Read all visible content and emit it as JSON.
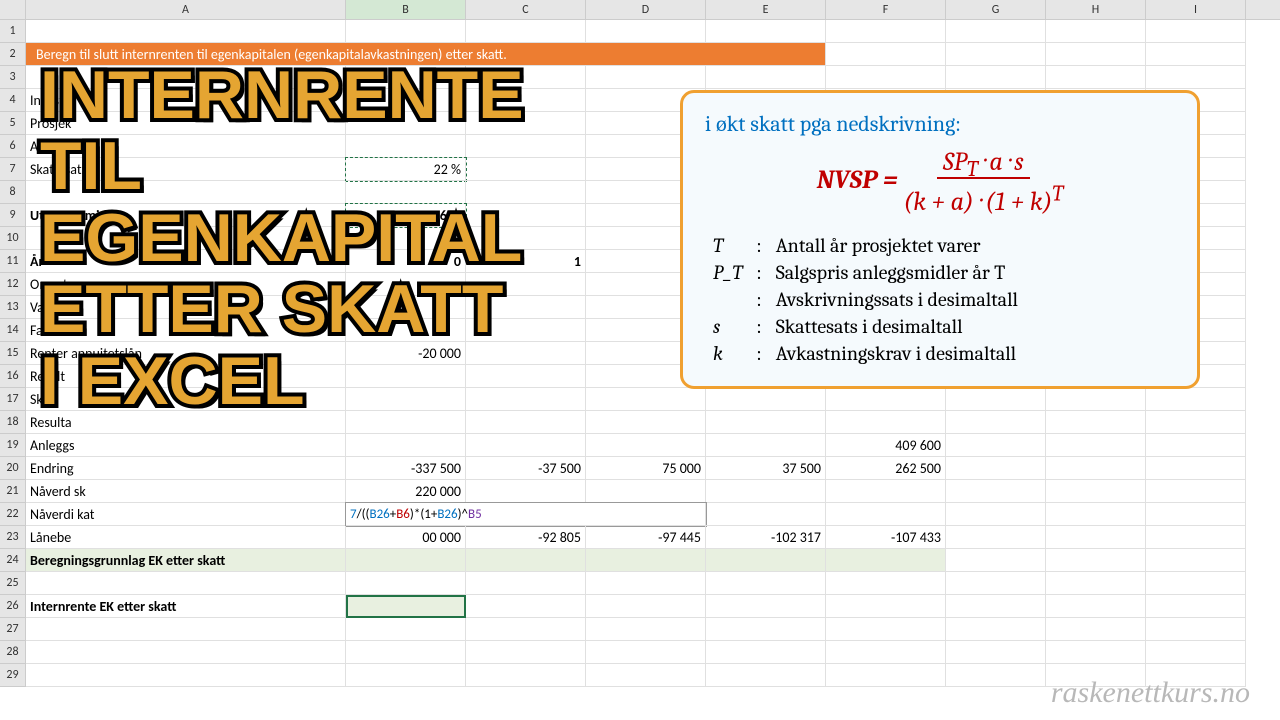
{
  "columns": [
    "A",
    "B",
    "C",
    "D",
    "E",
    "F",
    "G",
    "H",
    "I"
  ],
  "banner": "Beregn til slutt internrenten til egenkapitalen (egenkapitalavkastningen) etter skatt.",
  "rows": {
    "r4": {
      "A": "Investe"
    },
    "r5": {
      "A": "Prosjek"
    },
    "r6": {
      "A": "Avskriv"
    },
    "r7": {
      "A": "Skattesats",
      "B": "22 %"
    },
    "r9": {
      "A": "Utranger               midler",
      "B": "409 600"
    },
    "r11": {
      "A": "År",
      "B": "0",
      "C": "1"
    },
    "r12": {
      "A": "Omset"
    },
    "r13": {
      "A": "Variable"
    },
    "r14": {
      "A": "Faste k"
    },
    "r15": {
      "A": "Renter annuitetslån",
      "B": "-20 000"
    },
    "r16": {
      "A": "Result"
    },
    "r17": {
      "A": "Skatt"
    },
    "r18": {
      "A": "Resulta"
    },
    "r19": {
      "A": "Anleggs",
      "F": "409 600"
    },
    "r20": {
      "A": "Endring",
      "B": "-337 500",
      "C": "-37 500",
      "D": "75 000",
      "E": "37 500",
      "F": "262 500"
    },
    "r21": {
      "A": "Nåverd              sk",
      "B": "220 000"
    },
    "r22": {
      "A": "Nåverdi   kat",
      "B_formula": "7/((B26+B6)*(1+B26)^B5"
    },
    "r23": {
      "A": "Lånebe",
      "B": "00 000",
      "C": "-92 805",
      "D": "-97 445",
      "E": "-102 317",
      "F": "-107 433"
    },
    "r24": {
      "A": "Beregningsgrunnlag EK etter skatt"
    },
    "r26": {
      "A": "Internrente EK etter skatt"
    }
  },
  "title_lines": [
    "INTERNRENTE",
    "TIL",
    "EGENKAPITAL",
    "ETTER SKATT",
    "I EXCEL"
  ],
  "infobox": {
    "head": "i økt skatt pga nedskrivning:",
    "eq_lhs": "NVSP = ",
    "eq_top": "SP_T · a · s",
    "eq_bot": "(k + a) · (1 + k)^T",
    "defs": [
      {
        "sym": "T",
        "txt": "Antall år prosjektet varer"
      },
      {
        "sym": "P_T",
        "txt": "Salgspris anleggsmidler år T"
      },
      {
        "sym": "",
        "txt": "Avskrivningssats i desimaltall"
      },
      {
        "sym": "s",
        "txt": "Skattesats i desimaltall"
      },
      {
        "sym": "k",
        "txt": "Avkastningskrav i desimaltall"
      }
    ]
  },
  "watermark": "raskenettkurs.no"
}
